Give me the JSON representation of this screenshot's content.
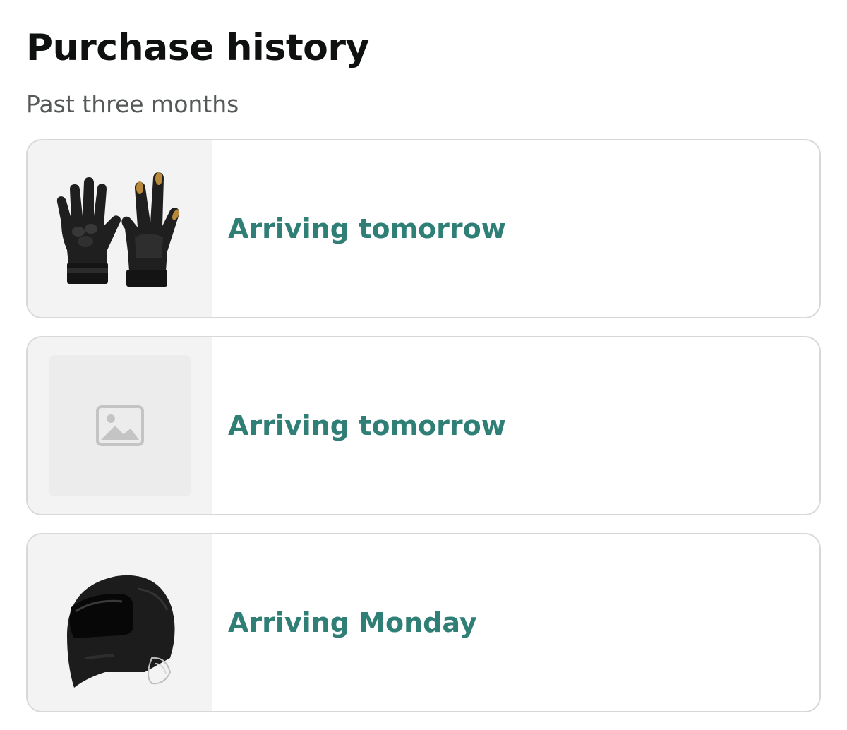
{
  "header": {
    "title": "Purchase history",
    "subtitle": "Past three months"
  },
  "orders": [
    {
      "status": "Arriving tomorrow",
      "thumbnail_icon": "gloves-icon"
    },
    {
      "status": "Arriving tomorrow",
      "thumbnail_icon": "product-image-placeholder-icon"
    },
    {
      "status": "Arriving Monday",
      "thumbnail_icon": "helmet-icon"
    }
  ],
  "colors": {
    "status_text": "#2f7f76",
    "title_text": "#0f1111",
    "subtitle_text": "#565959",
    "card_border": "#d5d9d9",
    "thumb_background": "#f3f3f3"
  }
}
